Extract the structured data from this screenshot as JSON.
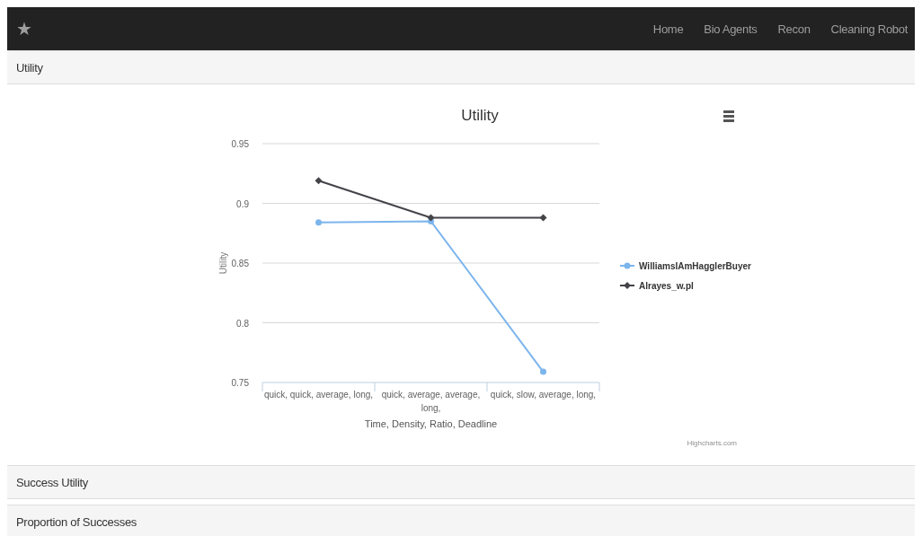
{
  "navbar": {
    "brand_icon": "★",
    "links": [
      {
        "label": "Home"
      },
      {
        "label": "Bio Agents"
      },
      {
        "label": "Recon"
      },
      {
        "label": "Cleaning Robot"
      }
    ]
  },
  "panels": [
    {
      "title": "Utility",
      "credit": "Highcharts.com",
      "chart_data": {
        "type": "line",
        "title": "Utility",
        "grid": true,
        "legend": true,
        "xlabel": "Time, Density, Ratio, Deadline",
        "ylabel": "Utility",
        "categories": [
          [
            "quick, quick, average, long,"
          ],
          [
            "quick, average, average,",
            "long,"
          ],
          [
            "quick, slow, average, long,"
          ]
        ],
        "ylim": [
          0.75,
          0.95
        ],
        "yticks": [
          {
            "value": 0.75,
            "label": "0.75"
          },
          {
            "value": 0.8,
            "label": "0.8"
          },
          {
            "value": 0.85,
            "label": "0.85"
          },
          {
            "value": 0.9,
            "label": "0.9"
          },
          {
            "value": 0.95,
            "label": "0.95"
          }
        ],
        "series": [
          {
            "name": "WilliamsIAmHagglerBuyer",
            "color": "#7cb5ec",
            "marker": "circle",
            "values": [
              0.884,
              0.885,
              0.759
            ]
          },
          {
            "name": "Alrayes_w.pl",
            "color": "#434348",
            "marker": "diamond",
            "values": [
              0.919,
              0.888,
              0.888
            ]
          }
        ]
      }
    },
    {
      "title": "Success Utility"
    },
    {
      "title": "Proportion of Successes"
    }
  ]
}
